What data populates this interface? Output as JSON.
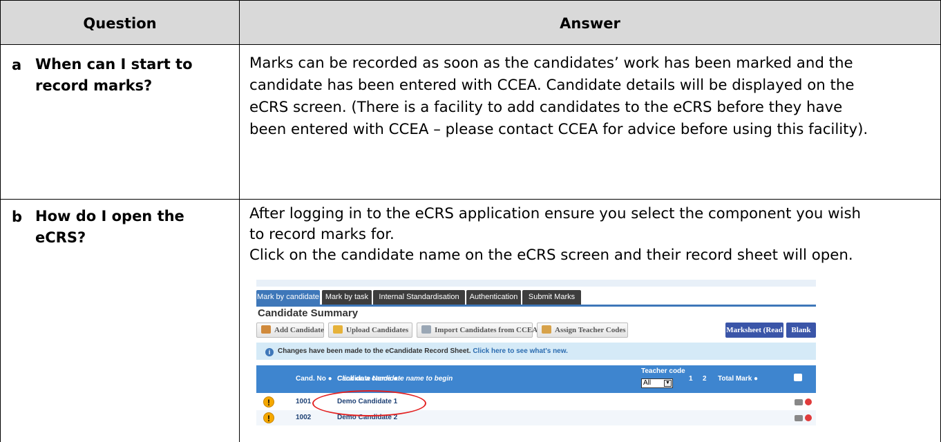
{
  "header": {
    "question": "Question",
    "answer": "Answer"
  },
  "rows": [
    {
      "letter": "a",
      "question_lines": [
        "When can I start to",
        "record marks?"
      ],
      "answer_lines": [
        "Marks can be recorded as soon as the candidates’ work has been marked and the",
        "candidate has been entered with CCEA.  Candidate details will be displayed on the",
        "eCRS screen.  (There is a facility to add candidates to the eCRS before they have",
        "been entered with CCEA – please contact CCEA for advice before using this facility)."
      ]
    },
    {
      "letter": "b",
      "question_lines": [
        "How do I open the",
        "eCRS?"
      ],
      "answer_lines": [
        "After logging in to the eCRS application ensure you select the component you wish",
        "to record marks for.",
        "Click on the candidate name on the eCRS screen and their record sheet will open."
      ]
    }
  ],
  "screenshot": {
    "tabs": [
      "Mark by candidate",
      "Mark by task",
      "Internal Standardisation",
      "Authentication",
      "Submit Marks"
    ],
    "active_tab": "Mark by candidate",
    "title": "Candidate Summary",
    "buttons": [
      "Add Candidate",
      "Upload Candidates",
      "Import Candidates from CCEA",
      "Assign Teacher Codes"
    ],
    "blue_buttons": [
      "Marksheet (Read Only)",
      "Blank eCRS"
    ],
    "notice": "Changes have been made to the eCandidate Record Sheet.",
    "notice_link": "Click here to see what's new.",
    "columns": {
      "cand_no": "Cand. No ●",
      "cand_name": "Candidate Name ● - ",
      "cand_name_hint": "Click on a candidate name to begin",
      "teacher_code": "Teacher code",
      "teacher_filter": "All",
      "col1": "1",
      "col2": "2",
      "total": "Total Mark ●"
    },
    "candidates": [
      {
        "no": "1001",
        "name": "Demo Candidate 1"
      },
      {
        "no": "1002",
        "name": "Demo Candidate 2"
      }
    ],
    "colors": {
      "tab_active": "#3e77b9",
      "header_blue": "#3e85cf",
      "highlight_ellipse": "#e32020"
    }
  }
}
